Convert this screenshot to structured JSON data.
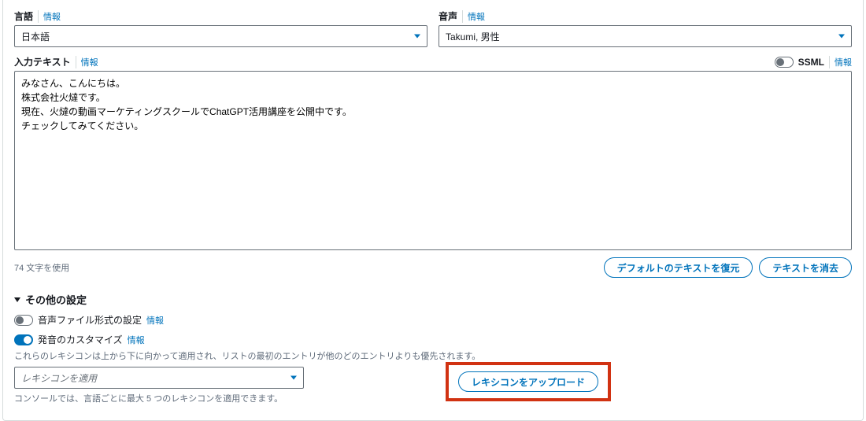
{
  "labels": {
    "language": "言語",
    "voice": "音声",
    "info": "情報",
    "input_text": "入力テキスト",
    "ssml": "SSML",
    "char_count": "74 文字を使用",
    "restore_default": "デフォルトのテキストを復元",
    "clear_text": "テキストを消去",
    "other_settings": "その他の設定",
    "audio_format": "音声ファイル形式の設定",
    "customize_pron": "発音のカスタマイズ",
    "customize_help": "これらのレキシコンは上から下に向かって適用され、リストの最初のエントリが他のどのエントリよりも優先されます。",
    "apply_lexicon": "レキシコンを適用",
    "console_help": "コンソールでは、言語ごとに最大 5 つのレキシコンを適用できます。",
    "upload_lexicon": "レキシコンをアップロード"
  },
  "values": {
    "language_selected": "日本語",
    "voice_selected": "Takumi, 男性",
    "text_content": "みなさん、こんにちは。\n株式会社火燵です。\n現在、火燵の動画マーケティングスクールでChatGPT活用講座を公開中です。\nチェックしてみてください。"
  }
}
